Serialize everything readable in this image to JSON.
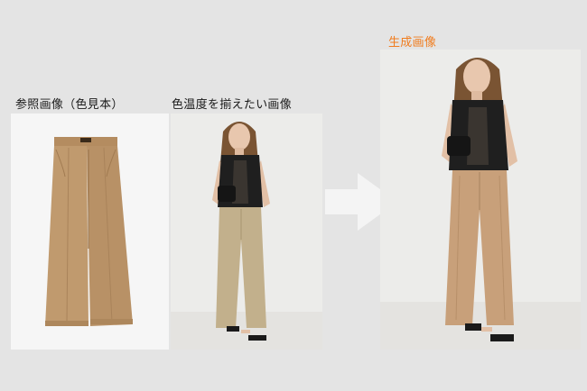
{
  "labels": {
    "reference": "参照画像（色見本）",
    "target": "色温度を揃えたい画像",
    "generated": "生成画像"
  },
  "colors": {
    "background": "#e4e4e4",
    "reference_bg": "#f6f6f6",
    "photo_bg": "#ececea",
    "pants_reference": "#c09a6e",
    "pants_target": "#c2b08c",
    "pants_generated": "#c8a07a",
    "vest": "#1f1f1f",
    "hair": "#7a5433",
    "skin": "#e8c7ae",
    "arrow": "#f4f4f4",
    "generated_label": "#f07c1e"
  },
  "icons": {
    "arrow": "arrow-right-icon"
  }
}
